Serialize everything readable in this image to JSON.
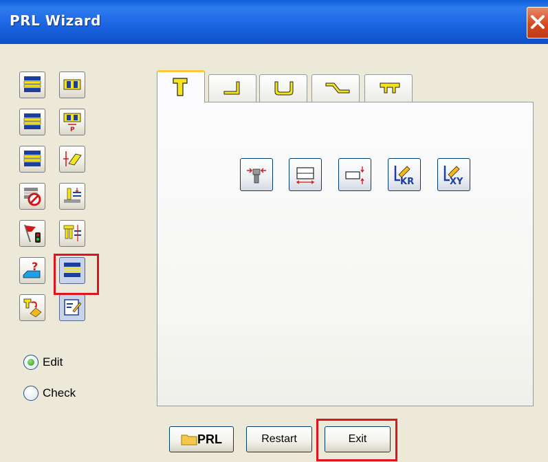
{
  "window": {
    "title": "PRL Wizard"
  },
  "icons": {
    "close": "close-icon",
    "tools": [
      "stack-plate-icon",
      "split-plate-icon",
      "stack-plate-2-icon",
      "split-plate-p-icon",
      "stack-plate-3-icon",
      "eraser-measure-icon",
      "no-stack-icon",
      "column-adjust-icon",
      "flag-signal-icon",
      "vertical-adjust-icon",
      "help-surface-icon",
      "stack-highlight-icon",
      "swap-tool-icon",
      "edit-sheet-icon"
    ],
    "tabs": [
      "punch-tab-icon",
      "corner-tab-icon",
      "u-channel-tab-icon",
      "offset-tab-icon",
      "flange-tab-icon"
    ],
    "panel_tools": [
      "punch-narrow-icon",
      "width-measure-icon",
      "height-measure-icon",
      "edit-kr-icon",
      "edit-xy-icon"
    ]
  },
  "panel_labels": {
    "kr": "KR",
    "xy": "XY"
  },
  "mode": {
    "options": [
      {
        "label": "Edit",
        "selected": true
      },
      {
        "label": "Check",
        "selected": false
      }
    ]
  },
  "buttons": {
    "prl": "PRL",
    "restart": "Restart",
    "exit": "Exit"
  },
  "colors": {
    "title_bar": "#1C66E3",
    "highlight": "#E0141E",
    "icon_yellow": "#F5E41A",
    "icon_blue": "#1A3FA0"
  }
}
